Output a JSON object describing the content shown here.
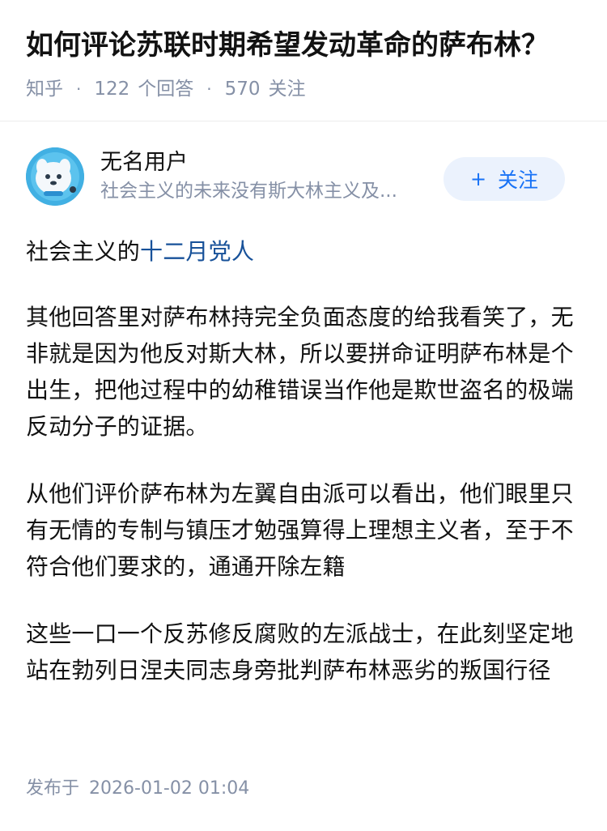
{
  "question": {
    "title": "如何评论苏联时期希望发动革命的萨布林？",
    "source": "知乎",
    "answer_count": "122",
    "answer_count_label": "个回答",
    "follow_count": "570",
    "follow_count_label": "关注"
  },
  "answer": {
    "author": {
      "name": "无名用户",
      "bio": "社会主义的未来没有斯大林主义及...",
      "avatar_icon": "blue-creature-avatar",
      "follow_button": {
        "plus": "+",
        "label": "关注"
      }
    },
    "paragraph_1": {
      "text_before_link": "社会主义的",
      "link_text": "十二月党人"
    },
    "paragraph_2": "其他回答里对萨布林持完全负面态度的给我看笑了，无非就是因为他反对斯大林，所以要拼命证明萨布林是个出生，把他过程中的幼稚错误当作他是欺世盗名的极端反动分子的证据。",
    "paragraph_3": "从他们评价萨布林为左翼自由派可以看出，他们眼里只有无情的专制与镇压才勉强算得上理想主义者，至于不符合他们要求的，通通开除左籍",
    "paragraph_4": "这些一口一个反苏修反腐败的左派战士，在此刻坚定地站在勃列日涅夫同志身旁批判萨布林恶劣的叛国行径",
    "publish_label": "发布于",
    "publish_time": "2026-01-02 01:04"
  },
  "colors": {
    "meta_gray": "#8590a6",
    "link_blue": "#175199",
    "follow_blue": "#1772f6",
    "follow_bg": "#ebf2fd"
  }
}
